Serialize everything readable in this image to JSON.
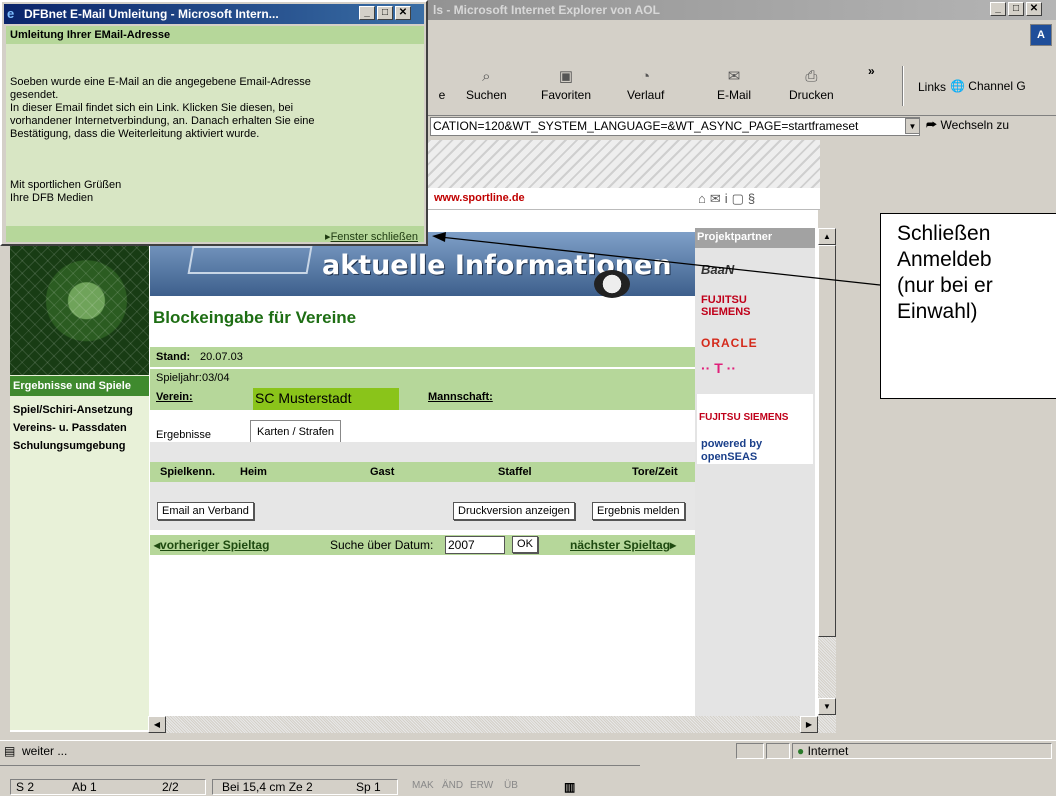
{
  "ie_window": {
    "title": "ls - Microsoft Internet Explorer von AOL",
    "toolbar": [
      {
        "label": "e"
      },
      {
        "label": "Suchen"
      },
      {
        "label": "Favoriten"
      },
      {
        "label": "Verlauf"
      },
      {
        "label": "E-Mail"
      },
      {
        "label": "Drucken"
      }
    ],
    "links_label": "Links",
    "channel_label": "Channel G",
    "address": "CATION=120&WT_SYSTEM_LANGUAGE=&WT_ASYNC_PAGE=startframeset",
    "go_label": "Wechseln zu",
    "status_text": "weiter ...",
    "zone_text": "Internet"
  },
  "site": {
    "sportline": "www.sportline.de",
    "banner_text": "aktuelle Informationen",
    "heading": "Blockeingabe für Vereine",
    "nav": {
      "active": "Ergebnisse und Spiele",
      "items": [
        "Spiel/Schiri-Ansetzung",
        "Vereins- u. Passdaten",
        "Schulungsumgebung"
      ]
    },
    "stand_label": "Stand:",
    "stand_value": "20.07.03",
    "spieljahr_label": "Spieljahr:",
    "spieljahr_value": "03/04",
    "verein_label": "Verein:",
    "verein_value": "SC Musterstadt",
    "mannschaft_label": "Mannschaft:",
    "tabs": [
      "Ergebnisse",
      "Karten / Strafen"
    ],
    "table_headers": [
      "Spielkenn.",
      "Heim",
      "Gast",
      "Staffel",
      "Tore/Zeit"
    ],
    "buttons": {
      "email": "Email an Verband",
      "print": "Druckversion anzeigen",
      "report": "Ergebnis melden"
    },
    "prev_link": "vorheriger Spieltag",
    "search_label": "Suche über Datum:",
    "search_value": "2007",
    "ok_label": "OK",
    "next_link": "nächster Spieltag",
    "partners_title": "Projektpartner",
    "partners": [
      "BaaN",
      "FUJITSU SIEMENS",
      "ORACLE",
      "·· T ··",
      "FUJITSU SIEMENS",
      "powered by openSEAS"
    ]
  },
  "popup": {
    "title": "DFBnet E-Mail Umleitung - Microsoft Intern...",
    "heading": "Umleitung Ihrer EMail-Adresse",
    "lines_1": [
      "Soeben wurde eine E-Mail an die angegebene Email-Adresse",
      "gesendet.",
      "In dieser Email findet sich ein Link. Klicken Sie diesen, bei",
      "vorhandener Internetverbindung, an. Danach erhalten Sie eine",
      "Bestätigung, dass die Weiterleitung aktiviert wurde."
    ],
    "lines_2": [
      "Mit sportlichen Grüßen",
      "Ihre DFB Medien"
    ],
    "close_link": "Fenster schließen"
  },
  "callout": {
    "text": "Schließen\nAnmeldeb\n(nur bei er\nEinwahl)"
  },
  "word_status": {
    "page": "S 2",
    "section": "Ab 1",
    "pages": "2/2",
    "position": "Bei 15,4 cm Ze 2",
    "column": "Sp 1",
    "modes": [
      "MAK",
      "ÄND",
      "ERW",
      "ÜB"
    ]
  }
}
